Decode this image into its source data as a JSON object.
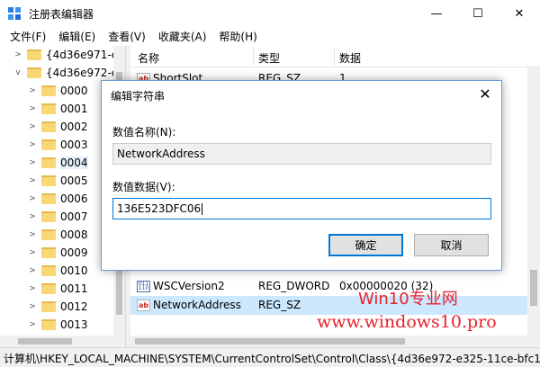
{
  "window": {
    "title": "注册表编辑器",
    "min_glyph": "—",
    "max_glyph": "☐",
    "close_glyph": "✕"
  },
  "menu": [
    {
      "label": "文件(F)"
    },
    {
      "label": "编辑(E)"
    },
    {
      "label": "查看(V)"
    },
    {
      "label": "收藏夹(A)"
    },
    {
      "label": "帮助(H)"
    }
  ],
  "tree": {
    "items": [
      {
        "label": "{4d36e971-e",
        "expanded": false,
        "selected": false
      },
      {
        "label": "{4d36e972-e",
        "expanded": true,
        "selected": false
      },
      {
        "label": "0000",
        "expanded": false,
        "selected": false
      },
      {
        "label": "0001",
        "expanded": false,
        "selected": false
      },
      {
        "label": "0002",
        "expanded": false,
        "selected": false
      },
      {
        "label": "0003",
        "expanded": false,
        "selected": false
      },
      {
        "label": "0004",
        "expanded": false,
        "selected": true
      },
      {
        "label": "0005",
        "expanded": false,
        "selected": false
      },
      {
        "label": "0006",
        "expanded": false,
        "selected": false
      },
      {
        "label": "0007",
        "expanded": false,
        "selected": false
      },
      {
        "label": "0008",
        "expanded": false,
        "selected": false
      },
      {
        "label": "0009",
        "expanded": false,
        "selected": false
      },
      {
        "label": "0010",
        "expanded": false,
        "selected": false
      },
      {
        "label": "0011",
        "expanded": false,
        "selected": false
      },
      {
        "label": "0012",
        "expanded": false,
        "selected": false
      },
      {
        "label": "0013",
        "expanded": false,
        "selected": false
      }
    ]
  },
  "list": {
    "columns": [
      "名称",
      "类型",
      "数据"
    ],
    "rows": [
      {
        "icon": "string-value-icon",
        "name": "ShortSlot",
        "type": "REG_SZ",
        "data": "1",
        "selected": false
      },
      {
        "icon": "binary-value-icon",
        "name": "WSCVersion2",
        "type": "REG_DWORD",
        "data": "0x00000020 (32)",
        "selected": false
      },
      {
        "icon": "string-value-icon",
        "name": "NetworkAddress",
        "type": "REG_SZ",
        "data": "",
        "selected": true
      }
    ]
  },
  "status": {
    "path": "计算机\\HKEY_LOCAL_MACHINE\\SYSTEM\\CurrentControlSet\\Control\\Class\\{4d36e972-e325-11ce-bfc1"
  },
  "watermark": {
    "line1": "Win10专业网",
    "line2": "www.windows10.pro"
  },
  "dialog": {
    "title": "编辑字符串",
    "close_glyph": "✕",
    "name_label": "数值名称(N):",
    "name_value": "NetworkAddress",
    "data_label": "数值数据(V):",
    "data_value": "136E523DFC06",
    "ok_label": "确定",
    "cancel_label": "取消"
  },
  "colors": {
    "accent": "#0078d7",
    "selection": "#cce8ff",
    "watermark": "#e8202a"
  }
}
